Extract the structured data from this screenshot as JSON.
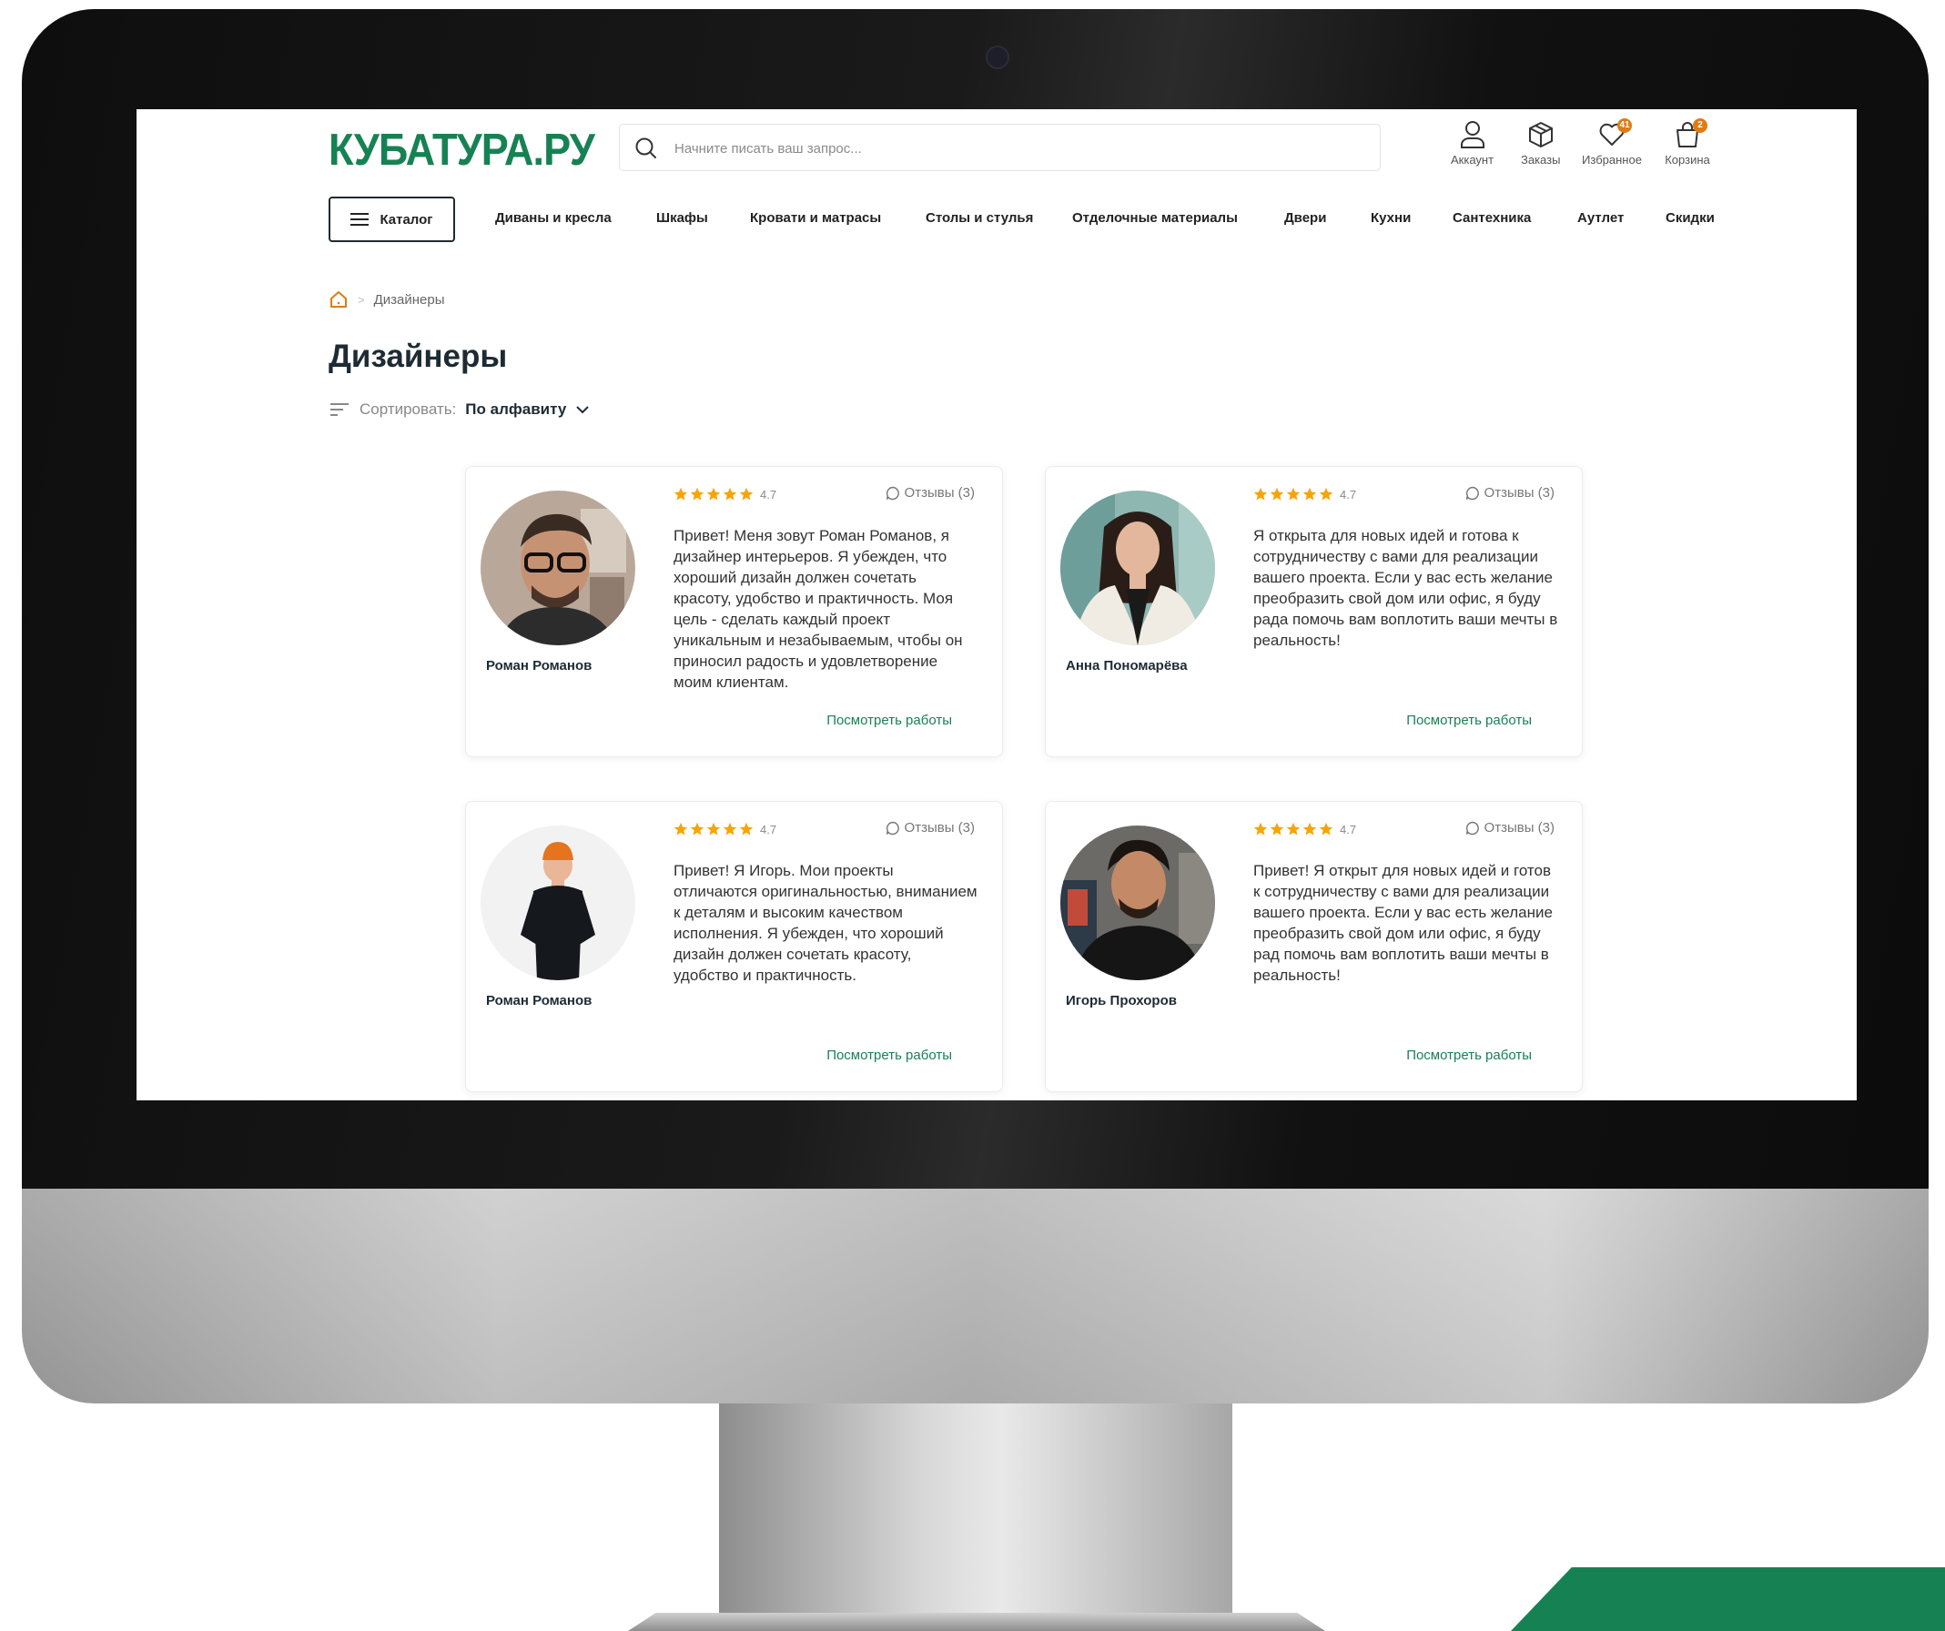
{
  "header": {
    "logo": "КУБАТУРА.РУ",
    "search_placeholder": "Начните писать ваш запрос...",
    "account_label": "Аккаунт",
    "orders_label": "Заказы",
    "favorites_label": "Избранное",
    "favorites_count": "41",
    "cart_label": "Корзина",
    "cart_count": "2"
  },
  "nav": {
    "catalog_label": "Каталог",
    "items": [
      "Диваны и кресла",
      "Шкафы",
      "Кровати и матрасы",
      "Столы и стулья",
      "Отделочные материалы",
      "Двери",
      "Кухни",
      "Сантехника",
      "Аутлет",
      "Скидки"
    ]
  },
  "breadcrumb": {
    "current": "Дизайнеры"
  },
  "page": {
    "title": "Дизайнеры",
    "sort_label": "Сортировать:",
    "sort_value": "По алфавиту"
  },
  "designers": [
    {
      "name": "Роман Романов",
      "rating": "4.7",
      "stars": 5,
      "reviews": "Отзывы (3)",
      "bio": "Привет! Меня зовут Роман Романов, я дизайнер интерьеров. Я убежден, что хороший дизайн должен сочетать красоту, удобство и практичность. Моя цель - сделать каждый проект уникальным и незабываемым, чтобы он приносил радость и удовлетворение моим клиентам.",
      "link": "Посмотреть работы"
    },
    {
      "name": "Анна Пономарёва",
      "rating": "4.7",
      "stars": 5,
      "reviews": "Отзывы (3)",
      "bio": "Я открыта для новых идей и готова к сотрудничеству с вами для реализации вашего проекта. Если у вас есть желание преобразить свой дом или офис, я буду рада помочь вам воплотить ваши мечты в реальность!",
      "link": "Посмотреть работы"
    },
    {
      "name": "Роман Романов",
      "rating": "4.7",
      "stars": 5,
      "reviews": "Отзывы (3)",
      "bio": "Привет! Я Игорь. Мои проекты отличаются оригинальностью, вниманием к деталям и высоким качеством исполнения. Я убежден, что хороший дизайн должен сочетать красоту, удобство и практичность.",
      "link": "Посмотреть работы"
    },
    {
      "name": "Игорь Прохоров",
      "rating": "4.7",
      "stars": 5,
      "reviews": "Отзывы (3)",
      "bio": "Привет! Я открыт для новых идей и готов к сотрудничеству с вами для реализации вашего проекта. Если у вас есть желание преобразить свой дом или офис, я буду рад помочь вам воплотить ваши мечты в реальность!",
      "link": "Посмотреть работы"
    }
  ],
  "colors": {
    "brand": "#168254",
    "star": "#f5a50a",
    "badge": "#e07b12",
    "title": "#1e2b33"
  }
}
